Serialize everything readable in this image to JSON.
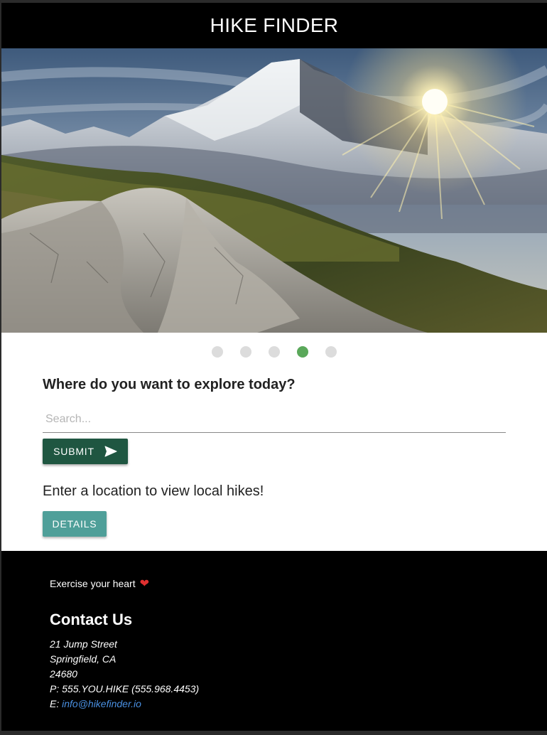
{
  "header": {
    "title": "HIKE FINDER"
  },
  "hero": {
    "icon": "mountain-sunset-image"
  },
  "carousel": {
    "count": 5,
    "active_index": 3,
    "active_color": "#5aa85a",
    "inactive_color": "#dcdcdc"
  },
  "search": {
    "question": "Where do you want to explore today?",
    "placeholder": "Search...",
    "value": "",
    "submit_label": "SUBMIT",
    "submit_icon": "send-icon"
  },
  "results": {
    "hint": "Enter a location to view local hikes!",
    "details_label": "DETAILS"
  },
  "footer": {
    "tagline": "Exercise your heart",
    "tagline_icon": "heart-icon",
    "contact_title": "Contact Us",
    "address_line1": "21 Jump Street",
    "address_line2": "Springfield, CA",
    "address_line3": "24680",
    "phone": "P: 555.YOU.HIKE (555.968.4453)",
    "email_prefix": "E: ",
    "email": "info@hikefinder.io"
  },
  "colors": {
    "header_bg": "#000000",
    "submit_bg": "#1f5641",
    "details_bg": "#4f9f99",
    "link": "#4a90e2"
  }
}
